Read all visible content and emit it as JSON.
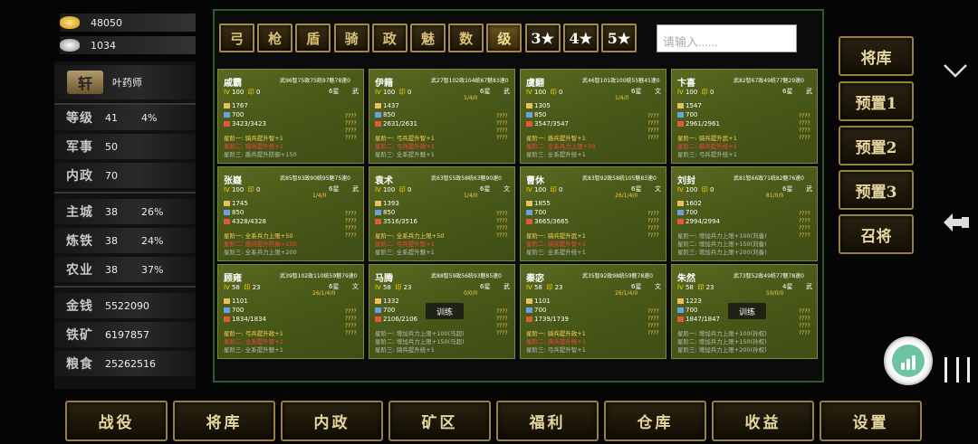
{
  "resources": {
    "gold": "48050",
    "silver": "1034"
  },
  "player": {
    "avatar_text": "轩",
    "name": "叶药师"
  },
  "stats": [
    {
      "label": "等级",
      "v1": "41",
      "v2": "4%"
    },
    {
      "label": "军事",
      "v1": "50",
      "v2": ""
    },
    {
      "label": "内政",
      "v1": "70",
      "v2": ""
    },
    {
      "label": "主城",
      "v1": "38",
      "v2": "26%"
    },
    {
      "label": "炼铁",
      "v1": "38",
      "v2": "24%"
    },
    {
      "label": "农业",
      "v1": "38",
      "v2": "37%"
    },
    {
      "label": "金钱",
      "v1": "5522090",
      "v2": ""
    },
    {
      "label": "铁矿",
      "v1": "6197857",
      "v2": ""
    },
    {
      "label": "粮食",
      "v1": "25262516",
      "v2": ""
    }
  ],
  "filter_tabs": [
    "弓",
    "枪",
    "盾",
    "骑",
    "政",
    "魅",
    "数",
    "级",
    "3★",
    "4★",
    "5★"
  ],
  "search": {
    "placeholder": "请输入......"
  },
  "cards": [
    {
      "name": "戚霸",
      "stats": "武96智75政75统97魅78速0",
      "lv": "100",
      "hp": "0",
      "star": "6星",
      "type": "武",
      "prog": "",
      "a1": "1767",
      "a2": "700",
      "a3": "3423/3423",
      "s1": "星阶一: 骑兵提升智+1",
      "s2": "星阶二: 骑兵提升统+1",
      "s3": "星阶三: 盾兵提升防御+150",
      "c1": "y",
      "c2": "r",
      "c3": "g",
      "train": ""
    },
    {
      "name": "伊籍",
      "stats": "武27智102政104统67魅83速0",
      "lv": "100",
      "hp": "0",
      "star": "6星",
      "type": "武",
      "prog": "1/4/0",
      "a1": "1437",
      "a2": "850",
      "a3": "2631/2631",
      "s1": "星阶一: 弓兵提升智+1",
      "s2": "星阶二: 弓兵提升政+1",
      "s3": "星阶三: 全系提升魅+1",
      "c1": "y",
      "c2": "r",
      "c3": "g",
      "train": ""
    },
    {
      "name": "虞翻",
      "stats": "武46智101政100统55魅45速0",
      "lv": "100",
      "hp": "0",
      "star": "6星",
      "type": "文",
      "prog": "1/4/0",
      "a1": "1305",
      "a2": "850",
      "a3": "3547/3547",
      "s1": "星阶一: 盾兵提升智+1",
      "s2": "星阶二: 全系兵力上限+50",
      "s3": "星阶三: 全系提升统+1",
      "c1": "y",
      "c2": "r",
      "c3": "g",
      "train": ""
    },
    {
      "name": "卞喜",
      "stats": "武82智67政49统77魅29速0",
      "lv": "100",
      "hp": "0",
      "star": "6星",
      "type": "武",
      "prog": "",
      "a1": "1547",
      "a2": "700",
      "a3": "2961/2961",
      "s1": "星阶一: 骑兵提升武+1",
      "s2": "星阶二: 骑兵提升统+1",
      "s3": "星阶三: 弓兵提升统+1",
      "c1": "y",
      "c2": "r",
      "c3": "g",
      "train": ""
    },
    {
      "name": "张嶷",
      "stats": "武85智93政90统95魅75速0",
      "lv": "100",
      "hp": "0",
      "star": "6星",
      "type": "武",
      "prog": "1/4/0",
      "a1": "1745",
      "a2": "850",
      "a3": "4328/4328",
      "s1": "星阶一: 全系兵力上限+50",
      "s2": "星阶二: 盾兵提升防御+150",
      "s3": "星阶三: 全系兵力上限+200",
      "c1": "y",
      "c2": "r",
      "c3": "g",
      "train": ""
    },
    {
      "name": "袁术",
      "stats": "武63智55政58统63魅90速0",
      "lv": "100",
      "hp": "0",
      "star": "6星",
      "type": "文",
      "prog": "1/4/0",
      "a1": "1393",
      "a2": "850",
      "a3": "3516/3516",
      "s1": "星阶一: 全系兵力上限+50",
      "s2": "星阶二: 弓兵提升智+1",
      "s3": "星阶三: 全系提升魅+1",
      "c1": "y",
      "c2": "r",
      "c3": "g",
      "train": ""
    },
    {
      "name": "曹休",
      "stats": "武83智92政58统105魅83速0",
      "lv": "100",
      "hp": "0",
      "star": "6星",
      "type": "文",
      "prog": "26/1/4/0",
      "a1": "1855",
      "a2": "700",
      "a3": "3665/3665",
      "s1": "星阶一: 骑兵提升武+1",
      "s2": "星阶二: 骑兵提升智+1",
      "s3": "星阶三: 全系提升统+1",
      "c1": "y",
      "c2": "r",
      "c3": "g",
      "train": ""
    },
    {
      "name": "刘封",
      "stats": "武81智66政71统82魅76速0",
      "lv": "100",
      "hp": "0",
      "star": "6星",
      "type": "武",
      "prog": "81/0/0",
      "a1": "1602",
      "a2": "700",
      "a3": "2994/2994",
      "s1": "星阶一: 增加兵力上限+100(刘备)",
      "s2": "星阶二: 增加兵力上限+150(刘备)",
      "s3": "星阶三: 增加兵力上限+200(刘备)",
      "c1": "g",
      "c2": "g",
      "c3": "g",
      "train": ""
    },
    {
      "name": "顾雍",
      "stats": "武39智102政110统59魅79速0",
      "lv": "58",
      "hp": "23",
      "star": "6星",
      "type": "文",
      "prog": "26/1/4/0",
      "a1": "1101",
      "a2": "700",
      "a3": "1834/1834",
      "s1": "星阶一: 弓兵提升政+1",
      "s2": "星阶二: 全系提升智+1",
      "s3": "星阶三: 全系提升魅+1",
      "c1": "y",
      "c2": "r",
      "c3": "g",
      "train": ""
    },
    {
      "name": "马腾",
      "stats": "武88智59政56统93魅85速0",
      "lv": "58",
      "hp": "23",
      "star": "6星",
      "type": "武",
      "prog": "0/0/0",
      "a1": "1332",
      "a2": "700",
      "a3": "2106/2106",
      "s1": "星阶一: 增加兵力上限+100(马超)",
      "s2": "星阶二: 增加兵力上限+150(马超)",
      "s3": "星阶三: 骑兵提升统+1",
      "c1": "g",
      "c2": "g",
      "c3": "g",
      "train": "训练"
    },
    {
      "name": "秦宓",
      "stats": "武35智92政98统59魅78速0",
      "lv": "58",
      "hp": "23",
      "star": "6星",
      "type": "文",
      "prog": "26/1/4/0",
      "a1": "1101",
      "a2": "700",
      "a3": "1739/1739",
      "s1": "星阶一: 骑兵提升政+1",
      "s2": "星阶二: 骑兵提升统+1",
      "s3": "星阶三: 弓兵提升智+1",
      "c1": "y",
      "c2": "r",
      "c3": "g",
      "train": ""
    },
    {
      "name": "朱然",
      "stats": "武73智52政49统77魅78速0",
      "lv": "58",
      "hp": "23",
      "star": "4星",
      "type": "武",
      "prog": "59/0/0",
      "a1": "1223",
      "a2": "700",
      "a3": "1847/1847",
      "s1": "星阶一: 增加兵力上限+100(孙权)",
      "s2": "星阶二: 增加兵力上限+150(孙权)",
      "s3": "星阶三: 增加兵力上限+200(孙权)",
      "c1": "g",
      "c2": "g",
      "c3": "g",
      "train": "训练"
    }
  ],
  "question_marks": "????",
  "right_buttons": [
    "将库",
    "预置1",
    "预置2",
    "预置3",
    "召将"
  ],
  "bottom_nav": [
    "战役",
    "将库",
    "内政",
    "矿区",
    "福利",
    "仓库",
    "收益",
    "设置"
  ],
  "icons": {
    "chevron": "chevron-down-icon",
    "push": "push-hand-icon",
    "float": "signal-float-icon",
    "recents": "recents-icon"
  },
  "colors": {
    "card_green": "#4a5a18",
    "gold_border": "#9a8040",
    "selected_tab": "#6a5420"
  }
}
